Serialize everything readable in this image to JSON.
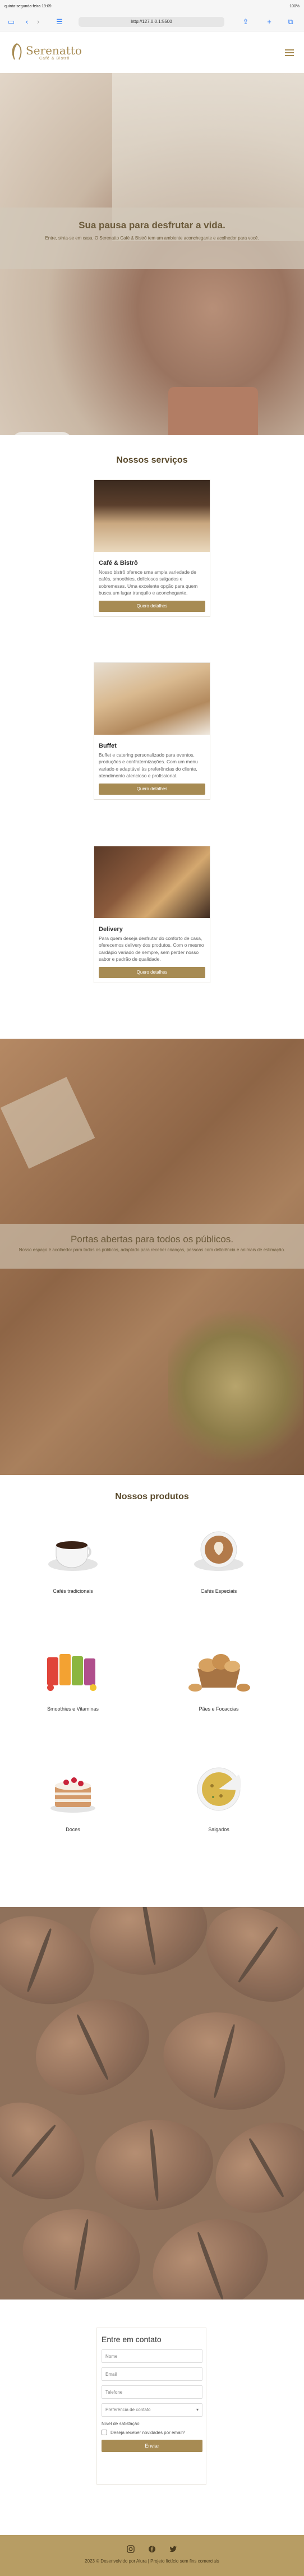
{
  "browser": {
    "time": "quinta-segunda-feira 19:09",
    "url": "http://127.0.0.1:5500",
    "battery": "100%"
  },
  "brand": {
    "name": "Serenatto",
    "tagline": "Café & Bistrô",
    "color": "#a78b53"
  },
  "hero": {
    "title": "Sua pausa para desfrutar a vida.",
    "subtitle": "Entre, sinta-se em casa. O Serenatto Café & Bistrô tem um ambiente aconchegante e acolhedor para você."
  },
  "services": {
    "title": "Nossos serviços",
    "items": [
      {
        "name": "Café & Bistrô",
        "text": "Nosso bistrô oferece uma ampla variedade de cafés, smoothies, deliciosos salgados e sobremesas. Uma excelente opção para quem busca um lugar tranquilo e aconchegante.",
        "button": "Quero detalhes"
      },
      {
        "name": "Buffet",
        "text": "Buffet e catering personalizado para eventos, produções e confraternizações. Com um menu variado e adaptável às preferências do cliente, atendimento atencioso e profissional.",
        "button": "Quero detalhes"
      },
      {
        "name": "Delivery",
        "text": "Para quem deseja desfrutar do conforto de casa, oferecemos delivery dos produtos. Com o mesmo cardápio variado de sempre, sem perder nosso sabor e padrão de qualidade.",
        "button": "Quero detalhes"
      }
    ]
  },
  "banner": {
    "title": "Portas abertas para todos os públicos.",
    "text": "Nosso espaço é acolhedor para todos os públicos, adaptado para receber crianças, pessoas com deficiência e animais de estimação."
  },
  "products": {
    "title": "Nossos produtos",
    "items": [
      {
        "label": "Cafés tradicionais",
        "icon": "coffee-cup-icon"
      },
      {
        "label": "Cafés Especiais",
        "icon": "latte-art-icon"
      },
      {
        "label": "Smoothies e Vitaminas",
        "icon": "smoothie-icon"
      },
      {
        "label": "Pães e Focaccias",
        "icon": "bread-basket-icon"
      },
      {
        "label": "Doces",
        "icon": "cake-icon"
      },
      {
        "label": "Salgados",
        "icon": "quiche-icon"
      }
    ]
  },
  "contact": {
    "title": "Entre em contato",
    "name_placeholder": "Nome",
    "email_placeholder": "Email",
    "phone_placeholder": "Telefone",
    "contact_pref": "Preferência de contato",
    "frequency_label": "Nível de satisfação",
    "newsletter": "Deseja receber novidades por email?",
    "submit": "Enviar"
  },
  "footer": {
    "copyright": "2023 © Desenvolvido por Alura | Projeto fictício sem fins comerciais",
    "socials": [
      "instagram-icon",
      "facebook-icon",
      "twitter-icon"
    ]
  }
}
